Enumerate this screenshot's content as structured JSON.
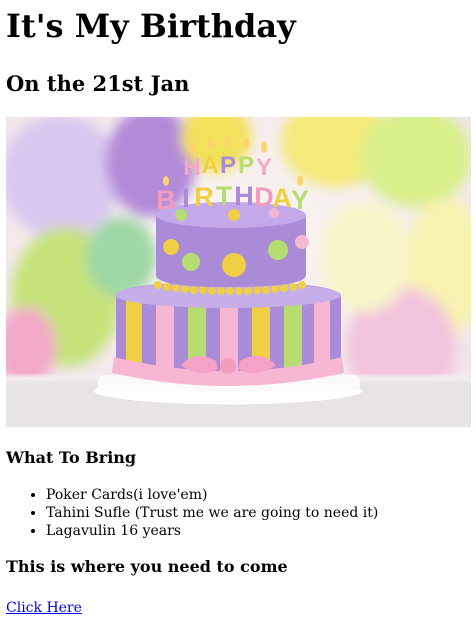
{
  "page": {
    "title": "It's My Birthday",
    "subtitle": "On the 21st Jan",
    "image": {
      "cake_topper": "HAPPY BIRTHDAY",
      "colors": {
        "background_light": "#f4ecf2",
        "balloon_purple": "#b18ad8",
        "balloon_yellow": "#f2e15a",
        "balloon_green": "#c6e37a",
        "balloon_pink": "#f3a9c8",
        "cake_purple": "#a98bd8",
        "cake_pink": "#f7b7d2",
        "dot_green": "#b6dc72",
        "dot_yellow": "#f0cf45"
      }
    },
    "bring_heading": "What To Bring",
    "bring_items": [
      "Poker Cards(i love'em)",
      "Tahini Sufle (Trust me we are going to need it)",
      "Lagavulin 16 years"
    ],
    "where_heading": "This is where you need to come",
    "link_label": "Click Here"
  }
}
